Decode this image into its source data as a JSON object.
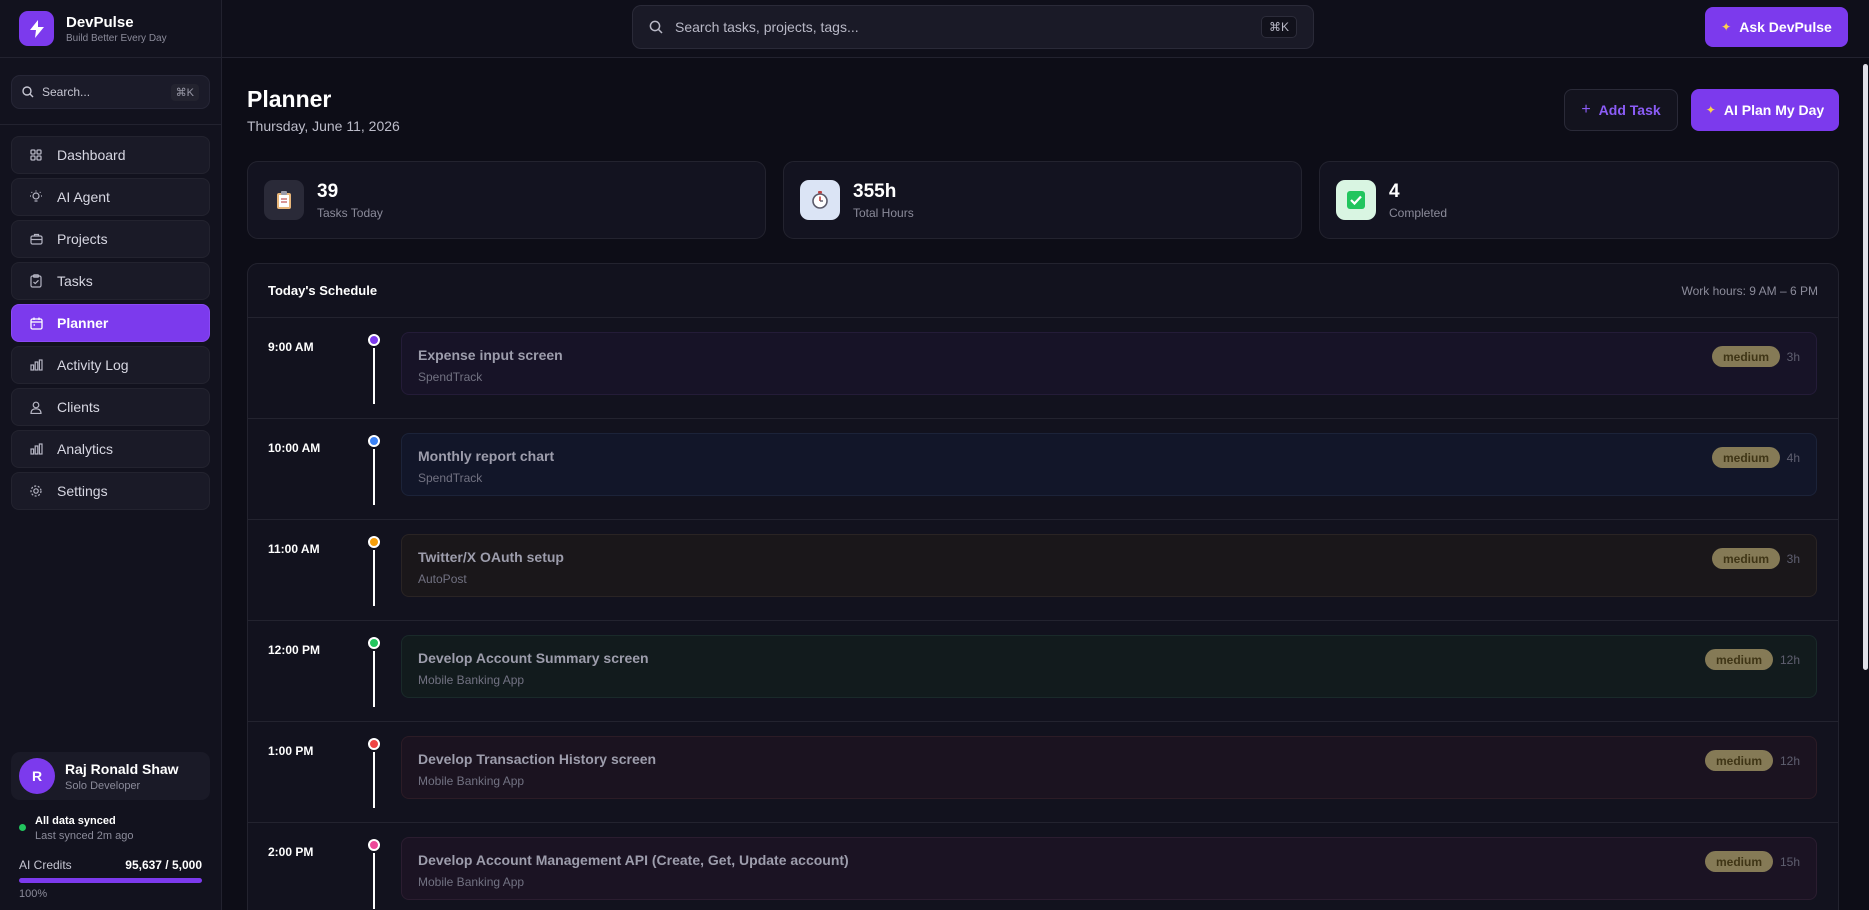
{
  "brand": {
    "name": "DevPulse",
    "tagline": "Build Better Every Day"
  },
  "sidebar": {
    "search_placeholder": "Search...",
    "search_shortcut": "⌘K",
    "items": [
      {
        "label": "Dashboard",
        "icon": "grid-icon"
      },
      {
        "label": "AI Agent",
        "icon": "bulb-icon"
      },
      {
        "label": "Projects",
        "icon": "briefcase-icon"
      },
      {
        "label": "Tasks",
        "icon": "clipboard-icon"
      },
      {
        "label": "Planner",
        "icon": "calendar-icon",
        "active": true
      },
      {
        "label": "Activity Log",
        "icon": "bar-chart-icon"
      },
      {
        "label": "Clients",
        "icon": "user-icon"
      },
      {
        "label": "Analytics",
        "icon": "bar-chart-icon"
      },
      {
        "label": "Settings",
        "icon": "gear-icon"
      }
    ],
    "user": {
      "initial": "R",
      "name": "Raj Ronald Shaw",
      "role": "Solo Developer"
    },
    "sync": {
      "title": "All data synced",
      "subtitle": "Last synced 2m ago"
    },
    "credits": {
      "label": "AI Credits",
      "value": "95,637 / 5,000",
      "percent_label": "100%",
      "fill_percent": 100
    }
  },
  "topbar": {
    "search_placeholder": "Search tasks, projects, tags...",
    "shortcut": "⌘K",
    "ask_label": "Ask DevPulse"
  },
  "page": {
    "title": "Planner",
    "date": "Thursday, June 11, 2026",
    "add_task_label": "Add Task",
    "ai_plan_label": "AI Plan My Day"
  },
  "stats": [
    {
      "value": "39",
      "label": "Tasks Today",
      "icon": "clipboard-icon"
    },
    {
      "value": "355h",
      "label": "Total Hours",
      "icon": "stopwatch-icon"
    },
    {
      "value": "4",
      "label": "Completed",
      "icon": "check-icon"
    }
  ],
  "schedule": {
    "title": "Today's Schedule",
    "work_hours": "Work hours: 9 AM – 6 PM",
    "rows": [
      {
        "time": "9:00 AM",
        "title": "Expense input screen",
        "project": "SpendTrack",
        "priority": "medium",
        "duration": "3h",
        "color": "#7c3aed",
        "bg": "#171327",
        "border": "#241c38"
      },
      {
        "time": "10:00 AM",
        "title": "Monthly report chart",
        "project": "SpendTrack",
        "priority": "medium",
        "duration": "4h",
        "color": "#3b82f6",
        "bg": "#121629",
        "border": "#1c2339"
      },
      {
        "time": "11:00 AM",
        "title": "Twitter/X OAuth setup",
        "project": "AutoPost",
        "priority": "medium",
        "duration": "3h",
        "color": "#f59e0b",
        "bg": "#1a171a",
        "border": "#2a2424"
      },
      {
        "time": "12:00 PM",
        "title": "Develop Account Summary screen",
        "project": "Mobile Banking App",
        "priority": "medium",
        "duration": "12h",
        "color": "#22c55e",
        "bg": "#121b1d",
        "border": "#1a2a2a"
      },
      {
        "time": "1:00 PM",
        "title": "Develop Transaction History screen",
        "project": "Mobile Banking App",
        "priority": "medium",
        "duration": "12h",
        "color": "#ef4444",
        "bg": "#1b1320",
        "border": "#2c1c26"
      },
      {
        "time": "2:00 PM",
        "title": "Develop Account Management API (Create, Get, Update account)",
        "project": "Mobile Banking App",
        "priority": "medium",
        "duration": "15h",
        "color": "#ec4899",
        "bg": "#1b1323",
        "border": "#2b1d30"
      }
    ]
  },
  "colors": {
    "accent": "#7c3aed",
    "badge": "#857a56",
    "success": "#22c55e"
  }
}
